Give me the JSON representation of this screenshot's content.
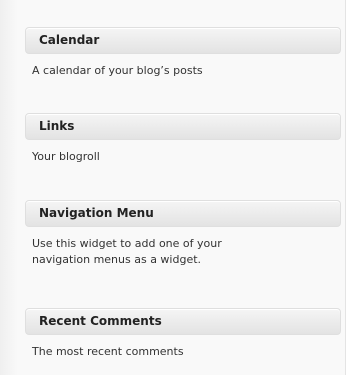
{
  "widgets": [
    {
      "title": "Calendar",
      "description": "A calendar of your blog’s posts"
    },
    {
      "title": "Links",
      "description": "Your blogroll"
    },
    {
      "title": "Navigation Menu",
      "description": "Use this widget to add one of your navigation menus as a widget."
    },
    {
      "title": "Recent Comments",
      "description": "The most recent comments"
    }
  ]
}
